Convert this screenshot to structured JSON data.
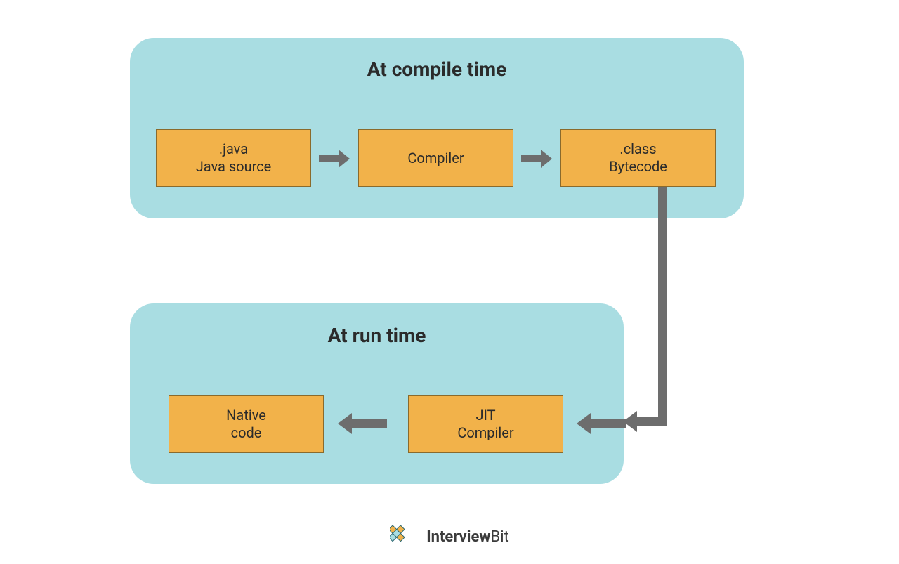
{
  "colors": {
    "panel_bg": "#a9dde2",
    "box_fill": "#f2b24a",
    "box_border": "#8a6a2c",
    "arrow": "#6d6d6d",
    "text": "#2b2b2b"
  },
  "compile": {
    "title": "At compile time",
    "java_source_line1": ".java",
    "java_source_line2": "Java source",
    "compiler_label": "Compiler",
    "bytecode_line1": ".class",
    "bytecode_line2": "Bytecode"
  },
  "runtime": {
    "title": "At run time",
    "jit_line1": "JIT",
    "jit_line2": "Compiler",
    "native_line1": "Native",
    "native_line2": "code"
  },
  "brand": {
    "part1": "Interview",
    "part2": "Bit"
  },
  "flow": [
    ".java Java source",
    "Compiler",
    ".class Bytecode",
    "JIT Compiler",
    "Native code"
  ]
}
